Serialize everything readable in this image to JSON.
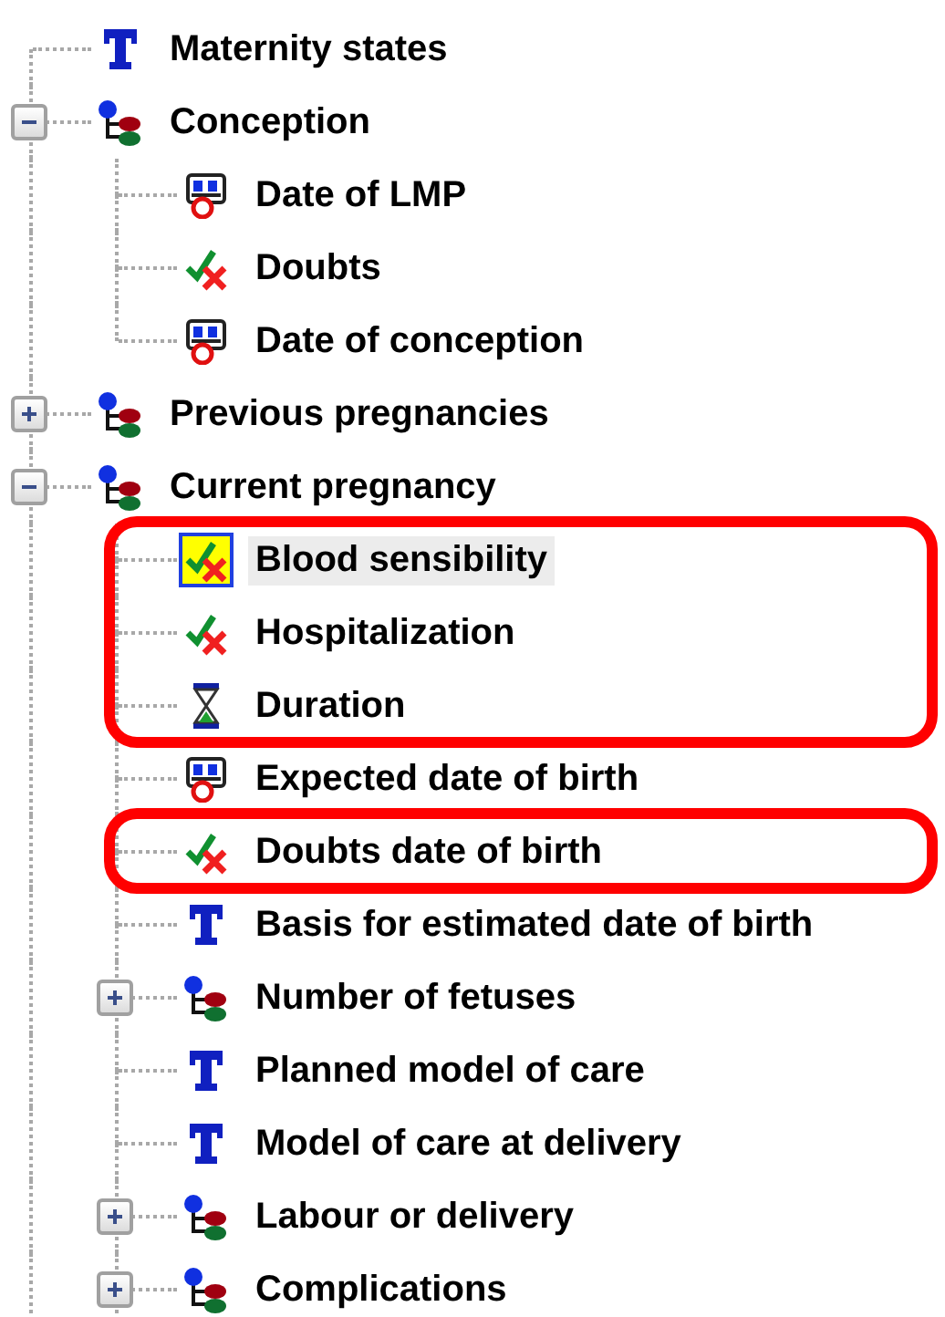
{
  "tree": [
    {
      "label": "Maternity states",
      "kind": "text",
      "selected": false
    },
    {
      "label": "Conception",
      "kind": "group",
      "selected": false,
      "expanded": true,
      "children": [
        {
          "label": "Date of LMP",
          "kind": "date",
          "selected": false
        },
        {
          "label": "Doubts",
          "kind": "boolean",
          "selected": false
        },
        {
          "label": "Date of conception",
          "kind": "date",
          "selected": false
        }
      ]
    },
    {
      "label": "Previous pregnancies",
      "kind": "group",
      "selected": false,
      "expanded": false
    },
    {
      "label": "Current pregnancy",
      "kind": "group",
      "selected": false,
      "expanded": true,
      "children": [
        {
          "label": "Blood sensibility",
          "kind": "boolean",
          "selected": true,
          "circled": true
        },
        {
          "label": "Hospitalization",
          "kind": "boolean",
          "selected": false,
          "circled": true
        },
        {
          "label": "Duration",
          "kind": "duration",
          "selected": false,
          "circled": true
        },
        {
          "label": "Expected date of birth",
          "kind": "date",
          "selected": false,
          "circled": false
        },
        {
          "label": "Doubts date of birth",
          "kind": "boolean",
          "selected": false,
          "circled": true
        },
        {
          "label": "Basis for estimated date of birth",
          "kind": "text",
          "selected": false,
          "circled": false
        },
        {
          "label": "Number of fetuses",
          "kind": "group",
          "selected": false,
          "expanded": false,
          "circled": false
        },
        {
          "label": "Planned model of care",
          "kind": "text",
          "selected": false,
          "circled": false
        },
        {
          "label": "Model of care at delivery",
          "kind": "text",
          "selected": false,
          "circled": false
        },
        {
          "label": "Labour or delivery",
          "kind": "group",
          "selected": false,
          "expanded": false,
          "circled": false
        },
        {
          "label": "Complications",
          "kind": "group",
          "selected": false,
          "expanded": false,
          "circled": false
        }
      ]
    }
  ]
}
